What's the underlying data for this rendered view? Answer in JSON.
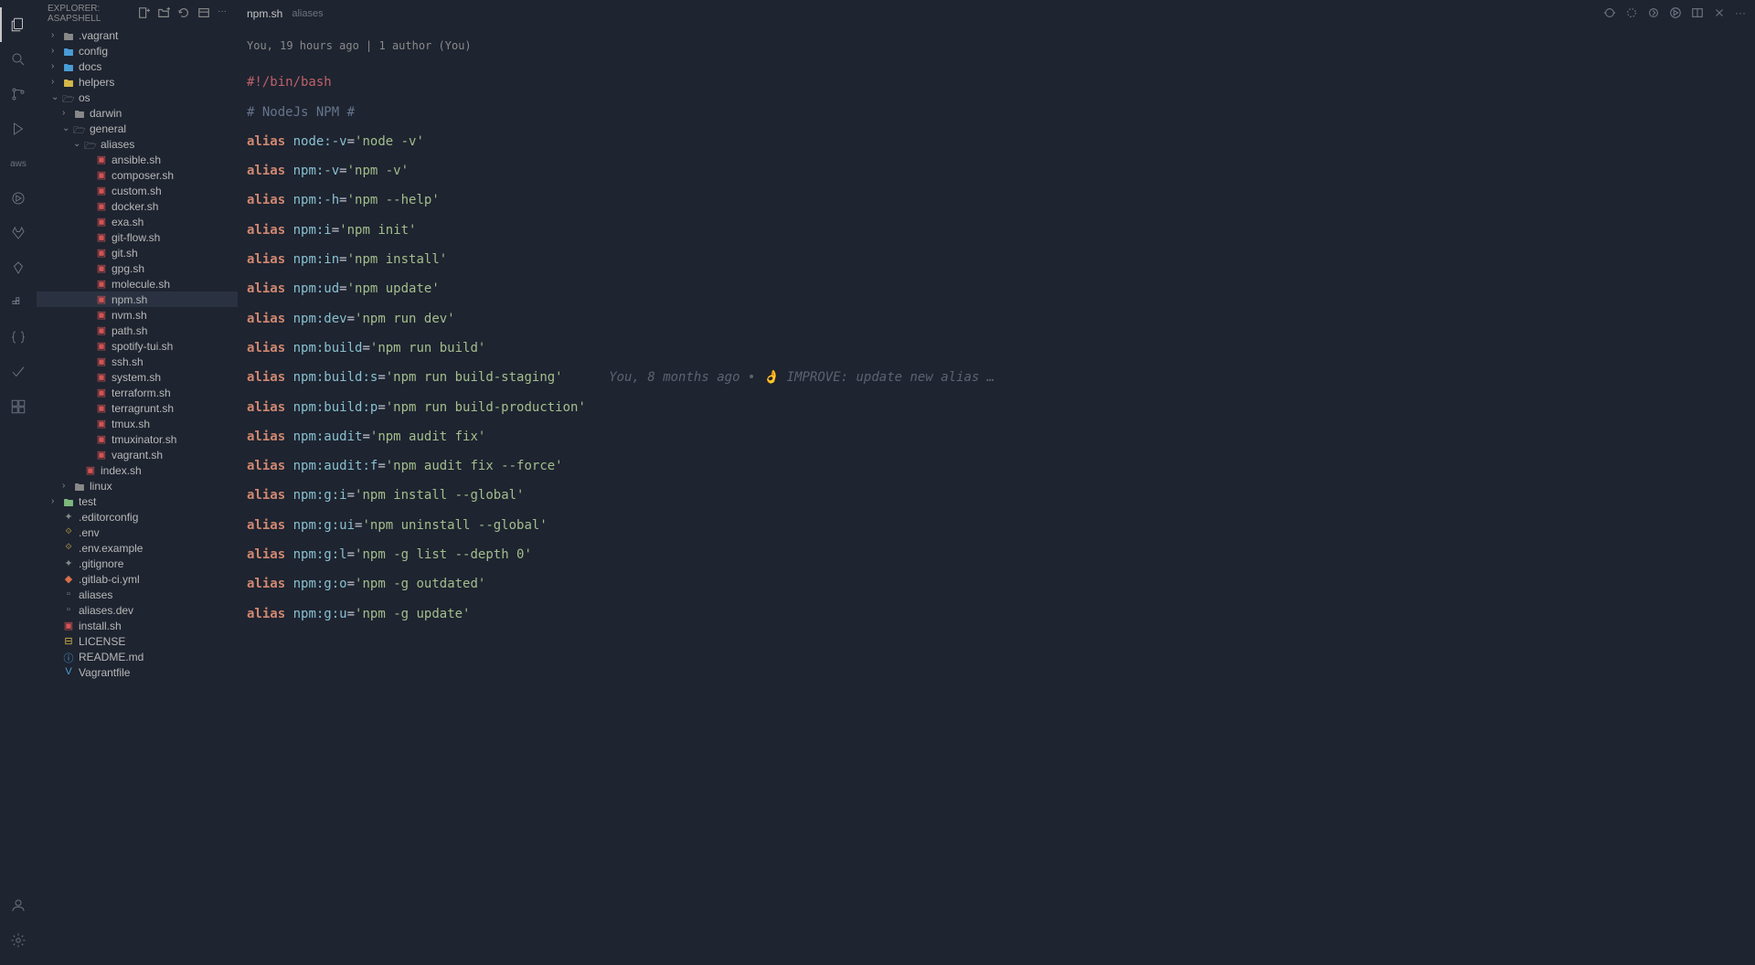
{
  "explorer": {
    "title": "EXPLORER: ASAPSHELL"
  },
  "tree": {
    "items": [
      {
        "indent": 1,
        "type": "folder",
        "name": ".vagrant",
        "chevron": ">",
        "icon": "folder"
      },
      {
        "indent": 1,
        "type": "folder",
        "name": "config",
        "chevron": ">",
        "icon": "folder-blue"
      },
      {
        "indent": 1,
        "type": "folder",
        "name": "docs",
        "chevron": ">",
        "icon": "folder-blue"
      },
      {
        "indent": 1,
        "type": "folder",
        "name": "helpers",
        "chevron": ">",
        "icon": "folder-yellow"
      },
      {
        "indent": 1,
        "type": "folder",
        "name": "os",
        "chevron": "v",
        "icon": "folder-open"
      },
      {
        "indent": 2,
        "type": "folder",
        "name": "darwin",
        "chevron": ">",
        "icon": "folder"
      },
      {
        "indent": 2,
        "type": "folder",
        "name": "general",
        "chevron": "v",
        "icon": "folder-open"
      },
      {
        "indent": 3,
        "type": "folder",
        "name": "aliases",
        "chevron": "v",
        "icon": "folder-open"
      },
      {
        "indent": 4,
        "type": "file",
        "name": "ansible.sh",
        "icon": "sh"
      },
      {
        "indent": 4,
        "type": "file",
        "name": "composer.sh",
        "icon": "sh"
      },
      {
        "indent": 4,
        "type": "file",
        "name": "custom.sh",
        "icon": "sh"
      },
      {
        "indent": 4,
        "type": "file",
        "name": "docker.sh",
        "icon": "sh"
      },
      {
        "indent": 4,
        "type": "file",
        "name": "exa.sh",
        "icon": "sh"
      },
      {
        "indent": 4,
        "type": "file",
        "name": "git-flow.sh",
        "icon": "sh"
      },
      {
        "indent": 4,
        "type": "file",
        "name": "git.sh",
        "icon": "sh"
      },
      {
        "indent": 4,
        "type": "file",
        "name": "gpg.sh",
        "icon": "sh"
      },
      {
        "indent": 4,
        "type": "file",
        "name": "molecule.sh",
        "icon": "sh"
      },
      {
        "indent": 4,
        "type": "file",
        "name": "npm.sh",
        "icon": "sh",
        "selected": true
      },
      {
        "indent": 4,
        "type": "file",
        "name": "nvm.sh",
        "icon": "sh"
      },
      {
        "indent": 4,
        "type": "file",
        "name": "path.sh",
        "icon": "sh"
      },
      {
        "indent": 4,
        "type": "file",
        "name": "spotify-tui.sh",
        "icon": "sh"
      },
      {
        "indent": 4,
        "type": "file",
        "name": "ssh.sh",
        "icon": "sh"
      },
      {
        "indent": 4,
        "type": "file",
        "name": "system.sh",
        "icon": "sh"
      },
      {
        "indent": 4,
        "type": "file",
        "name": "terraform.sh",
        "icon": "sh"
      },
      {
        "indent": 4,
        "type": "file",
        "name": "terragrunt.sh",
        "icon": "sh"
      },
      {
        "indent": 4,
        "type": "file",
        "name": "tmux.sh",
        "icon": "sh"
      },
      {
        "indent": 4,
        "type": "file",
        "name": "tmuxinator.sh",
        "icon": "sh"
      },
      {
        "indent": 4,
        "type": "file",
        "name": "vagrant.sh",
        "icon": "sh"
      },
      {
        "indent": 3,
        "type": "file",
        "name": "index.sh",
        "icon": "sh"
      },
      {
        "indent": 2,
        "type": "folder",
        "name": "linux",
        "chevron": ">",
        "icon": "folder"
      },
      {
        "indent": 1,
        "type": "folder",
        "name": "test",
        "chevron": ">",
        "icon": "folder-green"
      },
      {
        "indent": 1,
        "type": "file",
        "name": ".editorconfig",
        "icon": "config"
      },
      {
        "indent": 1,
        "type": "file",
        "name": ".env",
        "icon": "env"
      },
      {
        "indent": 1,
        "type": "file",
        "name": ".env.example",
        "icon": "env"
      },
      {
        "indent": 1,
        "type": "file",
        "name": ".gitignore",
        "icon": "config"
      },
      {
        "indent": 1,
        "type": "file",
        "name": ".gitlab-ci.yml",
        "icon": "gitlab"
      },
      {
        "indent": 1,
        "type": "file",
        "name": "aliases",
        "icon": "file"
      },
      {
        "indent": 1,
        "type": "file",
        "name": "aliases.dev",
        "icon": "file"
      },
      {
        "indent": 1,
        "type": "file",
        "name": "install.sh",
        "icon": "sh"
      },
      {
        "indent": 1,
        "type": "file",
        "name": "LICENSE",
        "icon": "license"
      },
      {
        "indent": 1,
        "type": "file",
        "name": "README.md",
        "icon": "info"
      },
      {
        "indent": 1,
        "type": "file",
        "name": "Vagrantfile",
        "icon": "vagrant"
      }
    ]
  },
  "tab": {
    "name": "npm.sh",
    "path": "aliases"
  },
  "codelens": "You, 19 hours ago | 1 author (You)",
  "activity": {
    "aws": "aws"
  },
  "blame": "You, 8 months ago • 👌 IMPROVE: update new alias …",
  "code_lines": [
    {
      "type": "shebang",
      "text": "#!/bin/bash"
    },
    {
      "type": "blank"
    },
    {
      "type": "comment",
      "text": "# NodeJs NPM #"
    },
    {
      "type": "blank"
    },
    {
      "type": "alias",
      "name": "node:-v",
      "value": "'node -v'"
    },
    {
      "type": "blank"
    },
    {
      "type": "alias",
      "name": "npm:-v",
      "value": "'npm -v'"
    },
    {
      "type": "blank"
    },
    {
      "type": "alias",
      "name": "npm:-h",
      "value": "'npm --help'"
    },
    {
      "type": "blank"
    },
    {
      "type": "alias",
      "name": "npm:i",
      "value": "'npm init'"
    },
    {
      "type": "blank"
    },
    {
      "type": "alias",
      "name": "npm:in",
      "value": "'npm install'"
    },
    {
      "type": "blank"
    },
    {
      "type": "alias",
      "name": "npm:ud",
      "value": "'npm update'"
    },
    {
      "type": "blank"
    },
    {
      "type": "alias",
      "name": "npm:dev",
      "value": "'npm run dev'"
    },
    {
      "type": "blank"
    },
    {
      "type": "alias",
      "name": "npm:build",
      "value": "'npm run build'"
    },
    {
      "type": "blank"
    },
    {
      "type": "alias",
      "name": "npm:build:s",
      "value": "'npm run build-staging'",
      "blame": true
    },
    {
      "type": "blank"
    },
    {
      "type": "alias",
      "name": "npm:build:p",
      "value": "'npm run build-production'"
    },
    {
      "type": "blank"
    },
    {
      "type": "alias",
      "name": "npm:audit",
      "value": "'npm audit fix'"
    },
    {
      "type": "blank"
    },
    {
      "type": "alias",
      "name": "npm:audit:f",
      "value": "'npm audit fix --force'"
    },
    {
      "type": "blank"
    },
    {
      "type": "alias",
      "name": "npm:g:i",
      "value": "'npm install --global'"
    },
    {
      "type": "blank"
    },
    {
      "type": "alias",
      "name": "npm:g:ui",
      "value": "'npm uninstall --global'"
    },
    {
      "type": "blank"
    },
    {
      "type": "alias",
      "name": "npm:g:l",
      "value": "'npm -g list --depth 0'"
    },
    {
      "type": "blank"
    },
    {
      "type": "alias",
      "name": "npm:g:o",
      "value": "'npm -g outdated'"
    },
    {
      "type": "blank"
    },
    {
      "type": "alias",
      "name": "npm:g:u",
      "value": "'npm -g update'"
    }
  ]
}
